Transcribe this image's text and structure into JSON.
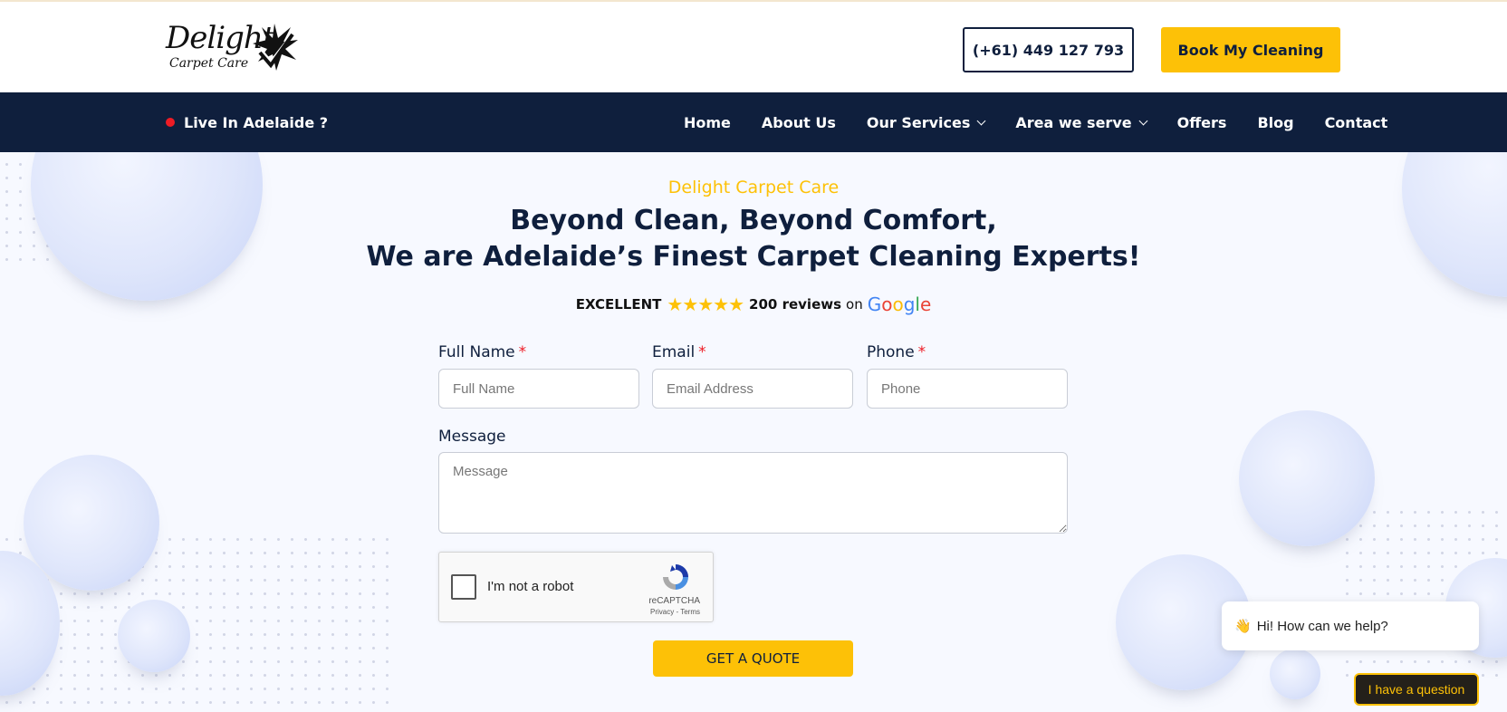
{
  "brand": {
    "logo_name": "Delight",
    "logo_sub": "Carpet   Care",
    "accent_color": "#fdc107",
    "navy_color": "#0f1f3d"
  },
  "header": {
    "phone_label": "(+61) 449 127 793",
    "book_label": "Book My Cleaning"
  },
  "navbar": {
    "live_label": "Live In Adelaide ?",
    "items": [
      {
        "label": "Home"
      },
      {
        "label": "About Us"
      },
      {
        "label": "Our Services"
      },
      {
        "label": "Area we serve"
      },
      {
        "label": "Offers"
      },
      {
        "label": "Blog"
      },
      {
        "label": "Contact"
      }
    ]
  },
  "hero": {
    "eyebrow": "Delight Carpet Care",
    "title_line1": "Beyond Clean, Beyond Comfort,",
    "title_line2": "We are Adelaide’s Finest Carpet Cleaning Experts!"
  },
  "reviews": {
    "rating_label": "EXCELLENT",
    "stars": "★★★★★",
    "count_label": "200 reviews",
    "on_label": "on",
    "google_letters": [
      "G",
      "o",
      "o",
      "g",
      "l",
      "e"
    ]
  },
  "form": {
    "full_name": {
      "label": "Full Name",
      "required": "*",
      "placeholder": "Full Name",
      "value": ""
    },
    "email": {
      "label": "Email",
      "required": "*",
      "placeholder": "Email Address",
      "value": ""
    },
    "phone": {
      "label": "Phone",
      "required": "*",
      "placeholder": "Phone",
      "value": ""
    },
    "message": {
      "label": "Message",
      "placeholder": "Message",
      "value": ""
    },
    "captcha": {
      "label": "I'm not a robot",
      "brand": "reCAPTCHA",
      "links": "Privacy - Terms"
    },
    "submit_label": "GET A QUOTE"
  },
  "chat": {
    "wave": "👋",
    "greeting": "Hi! How can we help?",
    "button_label": "I have a question"
  }
}
